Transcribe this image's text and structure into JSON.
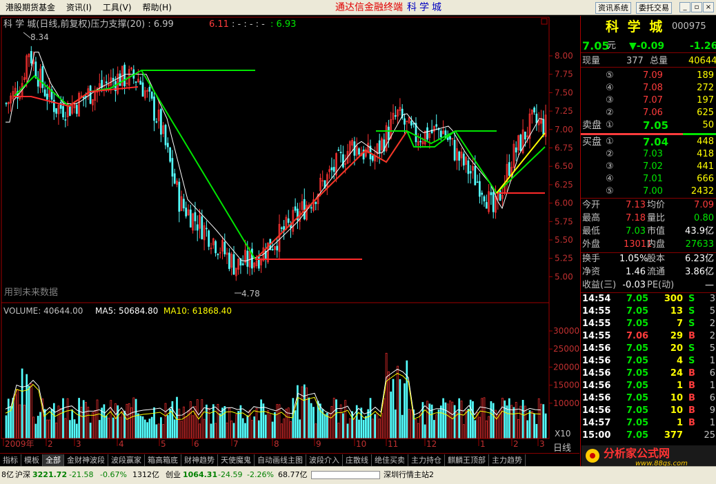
{
  "menu": [
    "港股期货基金",
    "资讯(I)",
    "工具(V)",
    "帮助(H)"
  ],
  "app_title": "通达信金融终端",
  "app_stock": "科学城",
  "top_buttons": [
    "资讯系统",
    "委托交易"
  ],
  "chart_header": {
    "name": "科 学 城(日线,前复权)压力支撑(20) : 6.99",
    "v1": "6.11",
    "sep": ": - : - : -",
    "v2": ": 6.93"
  },
  "price_axis": [
    "8.00",
    "7.75",
    "7.50",
    "7.25",
    "7.00",
    "6.75",
    "6.50",
    "6.25",
    "6.00",
    "5.75",
    "5.50",
    "5.25",
    "5.00"
  ],
  "high_label": "8.34",
  "low_label": "4.78",
  "future_text": "用到未来数据",
  "volume_header": {
    "volume": "VOLUME: 40644.00",
    "ma5": "MA5: 50684.80",
    "ma10": "MA10: 61868.40"
  },
  "volume_axis": [
    "30000",
    "25000",
    "20000",
    "15000",
    "10000"
  ],
  "volume_unit": "X10",
  "x_axis": [
    "2009年",
    "2",
    "3",
    "4",
    "5",
    "6",
    "7",
    "8",
    "9",
    "10",
    "11",
    "12",
    "1",
    "2",
    "3"
  ],
  "period_label": "日线",
  "tabs": [
    "指标",
    "模板",
    "全部",
    "金财神波段",
    "波段赢家",
    "箱高箱底",
    "财神趋势",
    "天使魔鬼",
    "自动画线主图",
    "波段介入",
    "庄散线",
    "绝佳买卖",
    "主力持仓",
    "麒麟王顶部",
    "主力趋势"
  ],
  "quote": {
    "stock_name": "科 学 城",
    "stock_code": "000975",
    "price": "7.05",
    "price_unit": "元",
    "change": "▼-0.09",
    "change_pct": "-1.26",
    "volume_label": "现量",
    "volume_now": "377",
    "total_label": "总量",
    "total_vol": "40644",
    "sell": [
      {
        "lvl": "⑤",
        "price": "7.09",
        "vol": "189"
      },
      {
        "lvl": "④",
        "price": "7.08",
        "vol": "272"
      },
      {
        "lvl": "③",
        "price": "7.07",
        "vol": "197"
      },
      {
        "lvl": "②",
        "price": "7.06",
        "vol": "625"
      },
      {
        "lvl": "①",
        "price": "7.05",
        "vol": "50",
        "label": "卖盘"
      }
    ],
    "buy": [
      {
        "lvl": "①",
        "price": "7.04",
        "vol": "448",
        "label": "买盘"
      },
      {
        "lvl": "②",
        "price": "7.03",
        "vol": "418"
      },
      {
        "lvl": "③",
        "price": "7.02",
        "vol": "441"
      },
      {
        "lvl": "④",
        "price": "7.01",
        "vol": "666"
      },
      {
        "lvl": "⑤",
        "price": "7.00",
        "vol": "2432"
      }
    ],
    "stats": [
      {
        "l1": "今开",
        "v1": "7.13",
        "c1": "red",
        "l2": "均价",
        "v2": "7.09",
        "c2": "red"
      },
      {
        "l1": "最高",
        "v1": "7.18",
        "c1": "red",
        "l2": "量比",
        "v2": "0.80",
        "c2": "green"
      },
      {
        "l1": "最低",
        "v1": "7.03",
        "c1": "green",
        "l2": "市值",
        "v2": "43.9亿",
        "c2": "white"
      },
      {
        "l1": "外盘",
        "v1": "13011",
        "c1": "red",
        "l2": "内盘",
        "v2": "27633",
        "c2": "green"
      }
    ],
    "stats2": [
      {
        "l1": "换手",
        "v1": "1.05%",
        "l2": "股本",
        "v2": "6.23亿"
      },
      {
        "l1": "净资",
        "v1": "1.46",
        "l2": "流通",
        "v2": "3.86亿"
      },
      {
        "l1": "收益(三)",
        "v1": "-0.03",
        "l2": "PE(动)",
        "v2": "—"
      }
    ],
    "ticks": [
      {
        "t": "14:54",
        "p": "7.05",
        "v": "300",
        "s": "S",
        "n": "3"
      },
      {
        "t": "14:55",
        "p": "7.05",
        "v": "13",
        "s": "S",
        "n": "5"
      },
      {
        "t": "14:55",
        "p": "7.05",
        "v": "7",
        "s": "S",
        "n": "2"
      },
      {
        "t": "14:55",
        "p": "7.06",
        "v": "29",
        "s": "B",
        "n": "2"
      },
      {
        "t": "14:56",
        "p": "7.05",
        "v": "20",
        "s": "S",
        "n": "5"
      },
      {
        "t": "14:56",
        "p": "7.05",
        "v": "4",
        "s": "S",
        "n": "1"
      },
      {
        "t": "14:56",
        "p": "7.05",
        "v": "24",
        "s": "B",
        "n": "6"
      },
      {
        "t": "14:56",
        "p": "7.05",
        "v": "1",
        "s": "B",
        "n": "1"
      },
      {
        "t": "14:56",
        "p": "7.05",
        "v": "10",
        "s": "B",
        "n": "6"
      },
      {
        "t": "14:56",
        "p": "7.05",
        "v": "10",
        "s": "B",
        "n": "9"
      },
      {
        "t": "14:57",
        "p": "7.05",
        "v": "1",
        "s": "B",
        "n": "1"
      },
      {
        "t": "15:00",
        "p": "7.05",
        "v": "377",
        "s": "",
        "n": "25"
      }
    ]
  },
  "status": {
    "s0": "8亿",
    "sh_label": "沪深",
    "sh_val": "3221.72",
    "sh_chg": "-21.58",
    "sh_pct": "-0.67%",
    "sh_amt": "1312亿",
    "cy_label": "创业",
    "cy_val": "1064.31",
    "cy_chg": "-24.59",
    "cy_pct": "-2.26%",
    "cy_amt": "68.77亿",
    "server": "深圳行情主站2"
  },
  "logo_text": "分析家公式网",
  "logo_url": "www.88gs.com"
}
